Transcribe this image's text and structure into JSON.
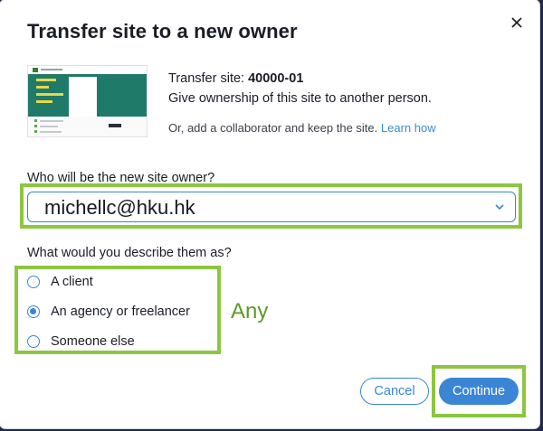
{
  "dialog": {
    "title": "Transfer site to a new owner",
    "close_icon": "close-icon"
  },
  "site": {
    "transfer_label": "Transfer site:",
    "site_id": "40000-01",
    "description": "Give ownership of this site to another person.",
    "alt_text": "Or, add a collaborator and keep the site.",
    "learn_how": "Learn how"
  },
  "owner": {
    "question": "Who will be the new site owner?",
    "value": "michellc@hku.hk",
    "chevron_icon": "chevron-down-icon"
  },
  "describe": {
    "question": "What would you describe them as?",
    "options": [
      {
        "label": "A client",
        "selected": false
      },
      {
        "label": "An agency or freelancer",
        "selected": true
      },
      {
        "label": "Someone else",
        "selected": false
      }
    ]
  },
  "annotation": {
    "any_label": "Any",
    "highlight_color": "#8cc63f"
  },
  "actions": {
    "cancel": "Cancel",
    "continue": "Continue"
  },
  "colors": {
    "accent": "#3a86d4",
    "title": "#1a1d27"
  }
}
